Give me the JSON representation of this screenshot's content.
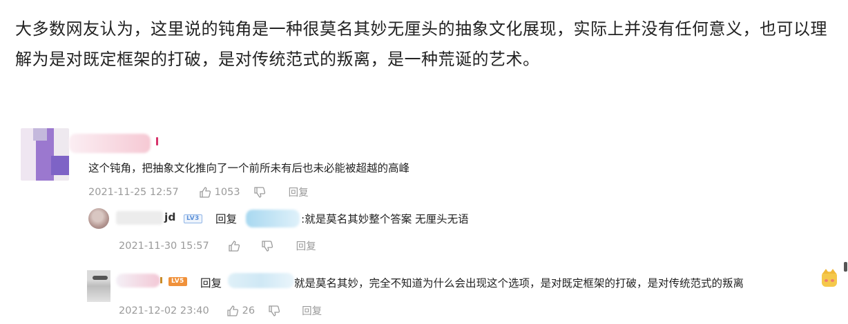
{
  "article": {
    "line1": "大多数网友认为，这里说的钝角是一种很莫名其妙无厘头的抽象文化展现，实际上并没有任何意义，也可以理",
    "line2": "解为是对既定框架的打破，是对传统范式的叛离，是一种荒诞的艺术。"
  },
  "comment": {
    "text": "这个钝角，把抽象文化推向了一个前所未有后也未必能被超越的高峰",
    "time": "2021-11-25 12:57",
    "likes": "1053",
    "reply_label": "回复",
    "icons": [
      "thumbs-up-icon",
      "thumbs-down-icon"
    ]
  },
  "replies": [
    {
      "name_suffix": "jd",
      "level": "LV3",
      "reply_prefix": "回复",
      "text": ":就是莫名其妙整个答案 无厘头无语",
      "time": "2021-11-30 15:57",
      "likes": "",
      "reply_label": "回复"
    },
    {
      "level": "LV5",
      "reply_prefix": "回复",
      "text": "就是莫名其妙，完全不知道为什么会出现这个选项，是对既定框架的打破，是对传统范式的叛离",
      "time": "2021-12-02 23:40",
      "likes": "26",
      "reply_label": "回复"
    }
  ],
  "colors": {
    "text": "#222222",
    "meta": "#9a9a9a",
    "lv3": "#5a8fd8",
    "lv5": "#f0913a"
  }
}
